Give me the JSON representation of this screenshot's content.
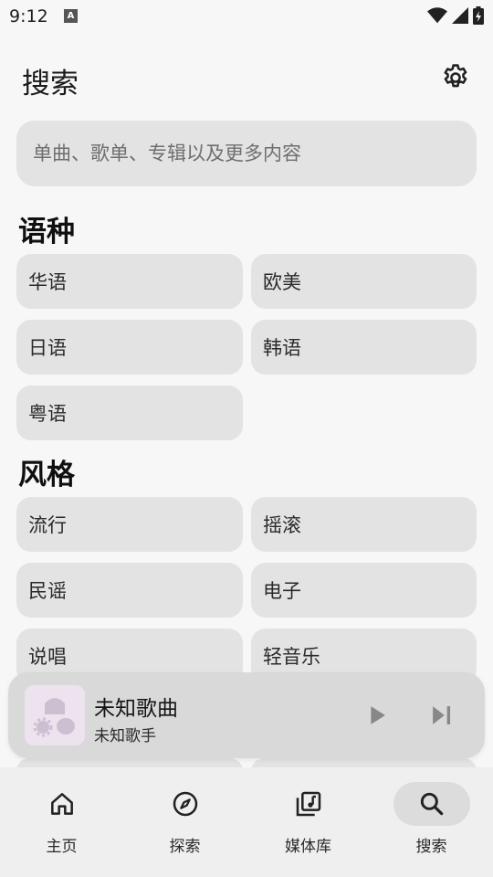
{
  "status_bar": {
    "time": "9:12",
    "notification_badge": "A"
  },
  "header": {
    "title": "搜索",
    "settings_icon": "gear-icon"
  },
  "search": {
    "placeholder": "单曲、歌单、专辑以及更多内容"
  },
  "sections": {
    "language": {
      "title": "语种",
      "items": [
        "华语",
        "欧美",
        "日语",
        "韩语",
        "粤语"
      ]
    },
    "genre": {
      "title": "风格",
      "items": [
        "流行",
        "摇滚",
        "民谣",
        "电子",
        "说唱",
        "轻音乐"
      ]
    }
  },
  "player": {
    "title": "未知歌曲",
    "artist": "未知歌手",
    "play_icon": "play-icon",
    "next_icon": "skip-next-icon"
  },
  "nav": {
    "items": [
      {
        "label": "主页",
        "icon": "home-icon"
      },
      {
        "label": "探索",
        "icon": "compass-icon"
      },
      {
        "label": "媒体库",
        "icon": "library-music-icon"
      },
      {
        "label": "搜索",
        "icon": "search-icon"
      }
    ],
    "active_index": 3
  },
  "colors": {
    "background": "#f7f7f7",
    "chip": "#e3e3e3",
    "player": "#d9d9d9",
    "nav": "#efefef"
  }
}
